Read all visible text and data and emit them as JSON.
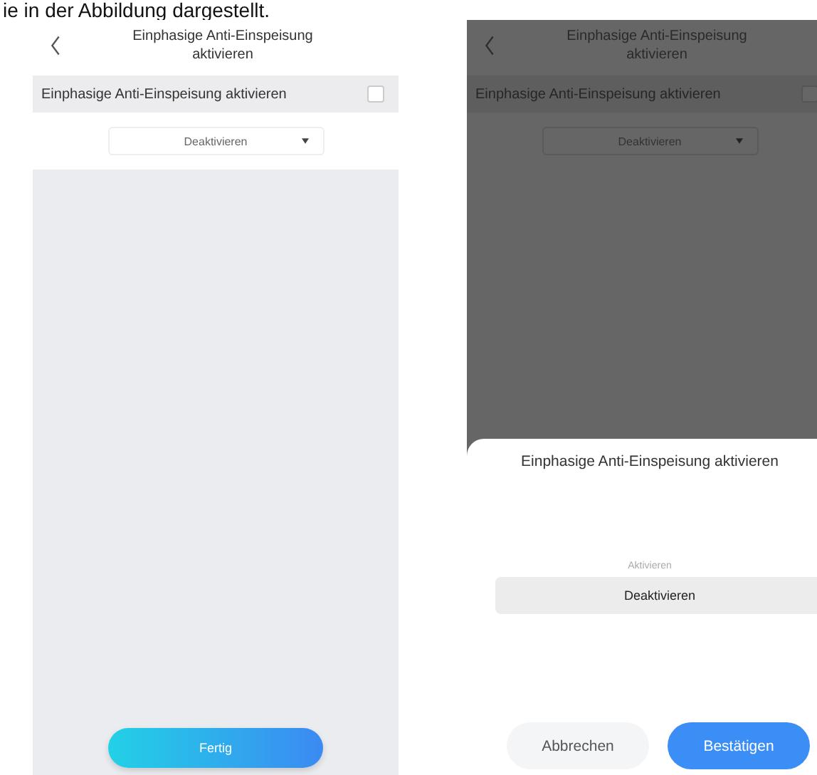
{
  "caption": "ie in der Abbildung dargestellt.",
  "screens": [
    {
      "kind": "page",
      "dimmed": false,
      "title": "Einphasige Anti-Einspeisung aktivieren",
      "row_label": "Einphasige Anti-Einspeisung aktivieren",
      "checked": false,
      "dropdown_value": "Deaktivieren",
      "done_button": "Fertig"
    },
    {
      "kind": "sheet",
      "dimmed": true,
      "title": "Einphasige Anti-Einspeisung aktivieren",
      "row_label": "Einphasige Anti-Einspeisung aktivieren",
      "checked": false,
      "dropdown_value": "Deaktivieren",
      "sheet": {
        "title": "Einphasige Anti-Einspeisung aktivieren",
        "options": [
          {
            "label": "Aktivieren",
            "selected": false
          },
          {
            "label": "Deaktivieren",
            "selected": true
          }
        ],
        "cancel": "Abbrechen",
        "confirm": "Bestätigen"
      }
    }
  ]
}
